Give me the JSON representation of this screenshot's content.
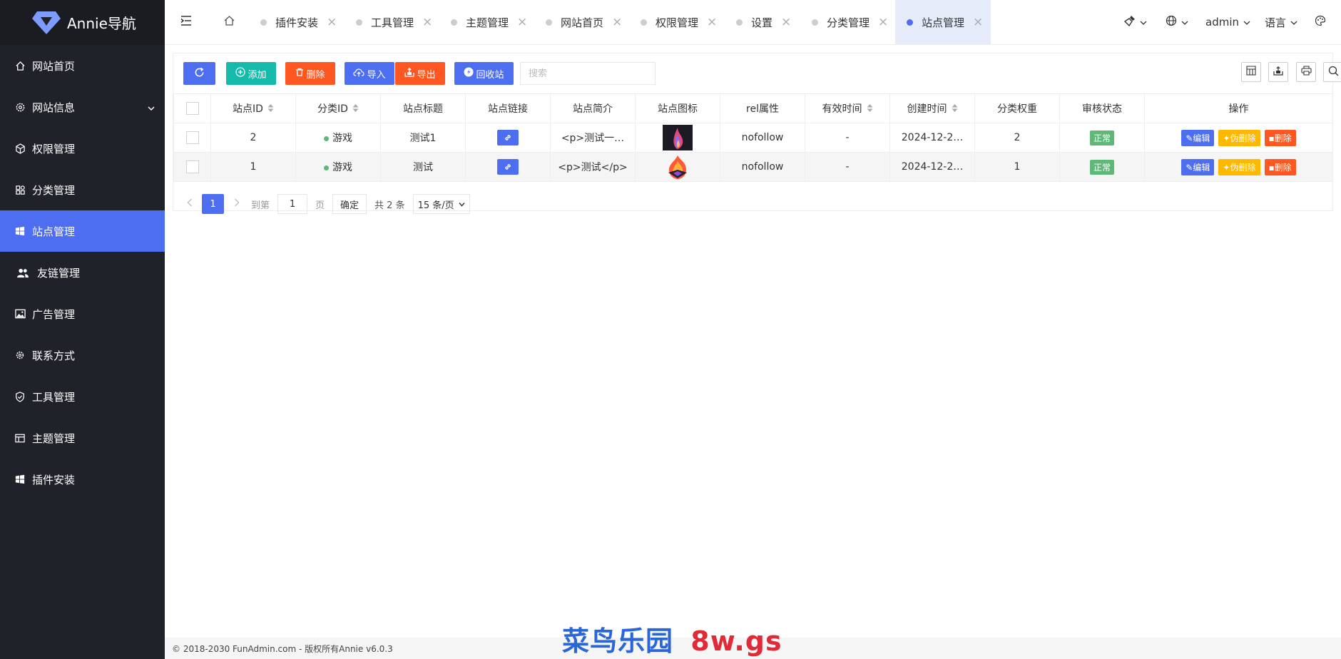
{
  "app": {
    "name": "Annie导航",
    "logo_icon": "diamond-logo"
  },
  "sidebar": {
    "items": [
      {
        "label": "网站首页",
        "icon": "home-icon"
      },
      {
        "label": "网站信息",
        "icon": "gear-icon",
        "has_arrow": true
      },
      {
        "label": "权限管理",
        "icon": "cube-icon"
      },
      {
        "label": "分类管理",
        "icon": "grid-icon"
      },
      {
        "label": "站点管理",
        "icon": "windows-icon",
        "active": true
      },
      {
        "label": "友链管理",
        "icon": "users-icon"
      },
      {
        "label": "广告管理",
        "icon": "image-icon"
      },
      {
        "label": "联系方式",
        "icon": "cog-icon"
      },
      {
        "label": "工具管理",
        "icon": "shield-icon"
      },
      {
        "label": "主题管理",
        "icon": "layout-icon"
      },
      {
        "label": "插件安装",
        "icon": "windows-icon"
      }
    ]
  },
  "topbar": {
    "tabs": [
      {
        "label": "插件安装"
      },
      {
        "label": "工具管理"
      },
      {
        "label": "主题管理"
      },
      {
        "label": "网站首页"
      },
      {
        "label": "权限管理"
      },
      {
        "label": "设置"
      },
      {
        "label": "分类管理"
      },
      {
        "label": "站点管理",
        "active": true
      }
    ],
    "user": "admin",
    "language": "语言"
  },
  "toolbar": {
    "add": "添加",
    "delete": "删除",
    "import": "导入",
    "export": "导出",
    "recycle": "回收站",
    "search_placeholder": "搜索"
  },
  "table": {
    "columns": [
      "站点ID",
      "分类ID",
      "站点标题",
      "站点链接",
      "站点简介",
      "站点图标",
      "rel属性",
      "有效时间",
      "创建时间",
      "分类权重",
      "审核状态",
      "操作"
    ],
    "rows": [
      {
        "id": "2",
        "category": "游戏",
        "title": "测试1",
        "intro": "<p>测试一…",
        "rel": "nofollow",
        "valid": "-",
        "created": "2024-12-2…",
        "weight": "2",
        "status": "正常"
      },
      {
        "id": "1",
        "category": "游戏",
        "title": "测试",
        "intro": "<p>测试</p>",
        "rel": "nofollow",
        "valid": "-",
        "created": "2024-12-2…",
        "weight": "1",
        "status": "正常"
      }
    ],
    "actions": {
      "edit": "编辑",
      "soft_delete": "伪删除",
      "delete": "删除"
    }
  },
  "pagination": {
    "current_page": "1",
    "goto_label": "到第",
    "goto_value": "1",
    "page_unit": "页",
    "confirm": "确定",
    "total": "共 2 条",
    "per_page": "15 条/页"
  },
  "footer": {
    "copyright": "© 2018-2030 FunAdmin.com - 版权所有Annie v6.0.3"
  },
  "watermark": {
    "part1": "菜鸟乐园",
    "part2": "8w.gs"
  },
  "colors": {
    "primary": "#4e6ef2",
    "teal": "#16baaa",
    "orange": "#ff5722",
    "warm": "#ffb800",
    "green": "#5fb878",
    "sidebar": "#20222a"
  }
}
